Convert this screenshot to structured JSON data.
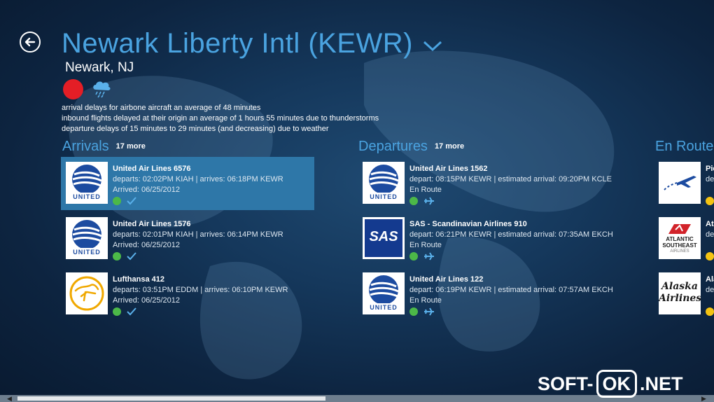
{
  "header": {
    "title": "Newark Liberty Intl (KEWR)",
    "subtitle": "Newark, NJ"
  },
  "status": {
    "indicator_color": "#e41e26",
    "weather_icon": "cloud-thunderstorm-icon",
    "notes": [
      "arrival delays for airbone aircraft an average of 48 minutes",
      "inbound flights delayed at their origin an average of 1 hours 55 minutes due to thunderstorms",
      "departure delays of 15 minutes to 29 minutes (and decreasing) due to weather"
    ]
  },
  "arrivals": {
    "title": "Arrivals",
    "more": "17 more",
    "items": [
      {
        "name": "United Air Lines 6576",
        "route": "departs: 02:02PM KIAH | arrives: 06:18PM KEWR",
        "status": "Arrived: 06/25/2012",
        "logo": "United"
      },
      {
        "name": "United Air Lines 1576",
        "route": "departs: 02:01PM KIAH | arrives: 06:14PM KEWR",
        "status": "Arrived: 06/25/2012",
        "logo": "United"
      },
      {
        "name": "Lufthansa 412",
        "route": "departs: 03:51PM EDDM | arrives: 06:10PM KEWR",
        "status": "Arrived: 06/25/2012",
        "logo": "Lufthansa"
      }
    ]
  },
  "departures": {
    "title": "Departures",
    "more": "17 more",
    "items": [
      {
        "name": "United Air Lines 1562",
        "route": "depart: 08:15PM KEWR | estimated arrival: 09:20PM KCLE",
        "status": "En Route",
        "logo": "United"
      },
      {
        "name": "SAS - Scandinavian Airlines 910",
        "route": "depart: 06:21PM KEWR | estimated arrival: 07:35AM EKCH",
        "status": "En Route",
        "logo": "SAS"
      },
      {
        "name": "United Air Lines 122",
        "route": "depart: 06:19PM KEWR | estimated arrival: 07:57AM EKCH",
        "status": "En Route",
        "logo": "United"
      }
    ]
  },
  "en_route": {
    "title": "En Route",
    "items": [
      {
        "name_fragment": "Pie",
        "detail_fragment": "de",
        "logo": "Piedmont"
      },
      {
        "name_fragment": "Atl",
        "detail_fragment": "de",
        "logo": "Atlantic Southeast"
      },
      {
        "name_fragment": "Ala",
        "detail_fragment": "de",
        "logo": "Alaska"
      }
    ]
  },
  "logo_text": {
    "united": "UNITED",
    "sas": "SAS",
    "asa_line1": "ATLANTIC",
    "asa_line2": "SOUTHEAST",
    "asa_line3": "AIRLINES",
    "alaska_line1": "Alaska",
    "alaska_line2": "Airlines"
  },
  "watermark": {
    "part1": "SOFT-",
    "part2": "OK",
    "part3": ".NET"
  },
  "colors": {
    "accent": "#4aa3e0",
    "selected": "#2e77a8",
    "arrived": "#4cb848",
    "en_route": "#4cb848",
    "alert": "#e41e26"
  }
}
